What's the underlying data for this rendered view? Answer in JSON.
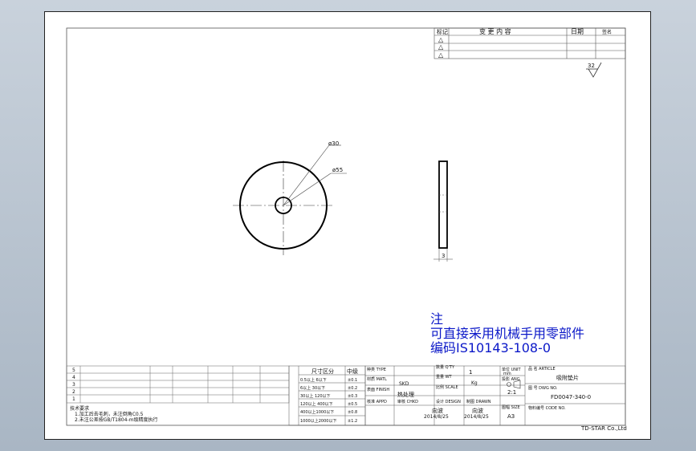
{
  "drawing": {
    "dimensions": {
      "inner_dia": "ø30",
      "outer_dia": "ø55",
      "thickness": "3"
    },
    "roughness": "32"
  },
  "revision_table": {
    "col_mark": "标记",
    "col_content": "变 更 内 容",
    "col_date": "日期",
    "col_sign": "签名",
    "marks": [
      "△",
      "△",
      "△"
    ]
  },
  "note": {
    "line1": "注",
    "line2": "可直接采用机械手用零部件",
    "line3": "编码IS10143-108-0"
  },
  "tech_requirements": {
    "title": "技术要求",
    "item1": "1.加工后去毛刺，未注倒角C0.5",
    "item2": "2.未注公差按GB/T1804-m级精度执行"
  },
  "left_table": {
    "row_numbers": [
      "5",
      "4",
      "3",
      "2",
      "1"
    ]
  },
  "tolerance_table": {
    "header_range": "尺寸区分",
    "header_grade": "中级",
    "rows": [
      {
        "range": "0.5以上 6以下",
        "grade": "±0.1"
      },
      {
        "range": "6以上 30以下",
        "grade": "±0.2"
      },
      {
        "range": "30以上 120以下",
        "grade": "±0.3"
      },
      {
        "range": "120以上 400以下",
        "grade": "±0.5"
      },
      {
        "range": "400以上1000以下",
        "grade": "±0.8"
      },
      {
        "range": "1000以上2000以下",
        "grade": "±1.2"
      }
    ]
  },
  "title_block": {
    "type_label": "种类 TYPE",
    "material_label": "材质 MATL",
    "material_value": "SKD",
    "finish_label": "表面 FINISH",
    "heat_label": "热处理",
    "approved_label": "核准 APPD",
    "checked_label": "审核 CHKD",
    "designer_label": "设计 DESIGN",
    "designer_name": "向波",
    "design_date": "2014/8/25",
    "drawn_label": "制图 DRAWN",
    "drawn_name": "向波",
    "drawn_date": "2014/8/25",
    "qty_label": "数量 Q'TY",
    "qty_value": "1",
    "weight_label": "重量 WT",
    "weight_value": "Kg",
    "scale_label": "比例 SCALE",
    "scale_value": "2:1",
    "unit_label": "单位 UNIT",
    "unit_value": "mm",
    "angle_label": "投影 ANG",
    "size_label": "图幅 SIZE",
    "size_value": "A3",
    "part_name_label": "品 名 ARTICLE",
    "part_name": "吸附垫片",
    "dwg_no_label": "图 号 DWG NO.",
    "dwg_no": "FD0047-340-0",
    "code_label": "物料编号 CODE NO.",
    "company": "TD-STAR Co.,Ltd"
  }
}
